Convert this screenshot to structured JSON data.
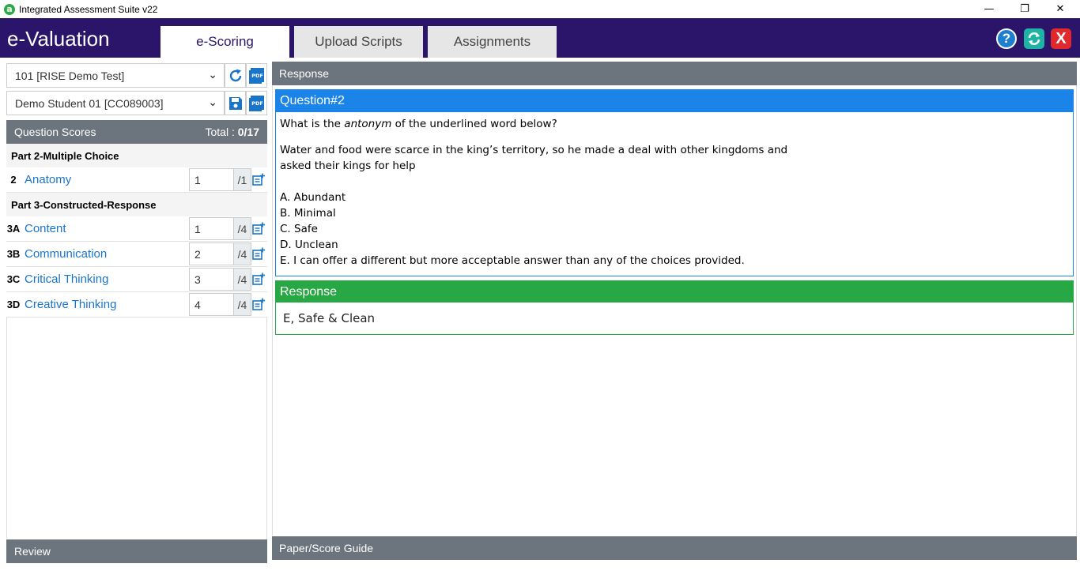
{
  "window": {
    "title": "Integrated Assessment Suite v22",
    "logo_letter": "a",
    "controls": {
      "minimize": "—",
      "restore": "❐",
      "close": "✕"
    }
  },
  "header": {
    "brand": "e-Valuation",
    "tabs": [
      {
        "label": "e-Scoring",
        "active": true
      },
      {
        "label": "Upload Scripts",
        "active": false
      },
      {
        "label": "Assignments",
        "active": false
      }
    ],
    "buttons": {
      "help": "?",
      "close": "X"
    }
  },
  "left": {
    "test_select": "101 [RISE Demo Test]",
    "student_select": "Demo Student 01 [CC089003]",
    "pdf_label": "PDF",
    "scores_header": "Question Scores",
    "total_label": "Total :",
    "total_value": "0/17",
    "parts": [
      {
        "title": "Part 2-Multiple Choice"
      },
      {
        "title": "Part 3-Constructed-Response"
      }
    ],
    "rows": [
      {
        "num": "2",
        "name": "Anatomy",
        "score": "1",
        "max": "/1"
      },
      {
        "num": "3A",
        "name": "Content",
        "score": "1",
        "max": "/4"
      },
      {
        "num": "3B",
        "name": "Communication",
        "score": "2",
        "max": "/4"
      },
      {
        "num": "3C",
        "name": "Critical Thinking",
        "score": "3",
        "max": "/4"
      },
      {
        "num": "3D",
        "name": "Creative Thinking",
        "score": "4",
        "max": "/4"
      }
    ],
    "review_header": "Review"
  },
  "right": {
    "response_header": "Response",
    "question": {
      "title": "Question#2",
      "prompt_before": "What is the ",
      "prompt_em": "antonym",
      "prompt_after": " of the underlined word below?",
      "passage_line1": "Water and food were scarce in the king’s territory, so he made a deal with other kingdoms and",
      "passage_line2": "asked their kings for help",
      "choices": [
        "A. Abundant",
        "B. Minimal",
        "C. Safe",
        "D. Unclean",
        "E. I can offer a different but more acceptable answer than any of the choices provided."
      ]
    },
    "response": {
      "title": "Response",
      "text": "E, Safe & Clean"
    },
    "guide_header": "Paper/Score Guide"
  },
  "colors": {
    "header_bg": "#2a156b",
    "panel_head": "#6c757d",
    "question_blue": "#1a84e8",
    "response_green": "#28a745",
    "link_blue": "#1a75c9"
  }
}
